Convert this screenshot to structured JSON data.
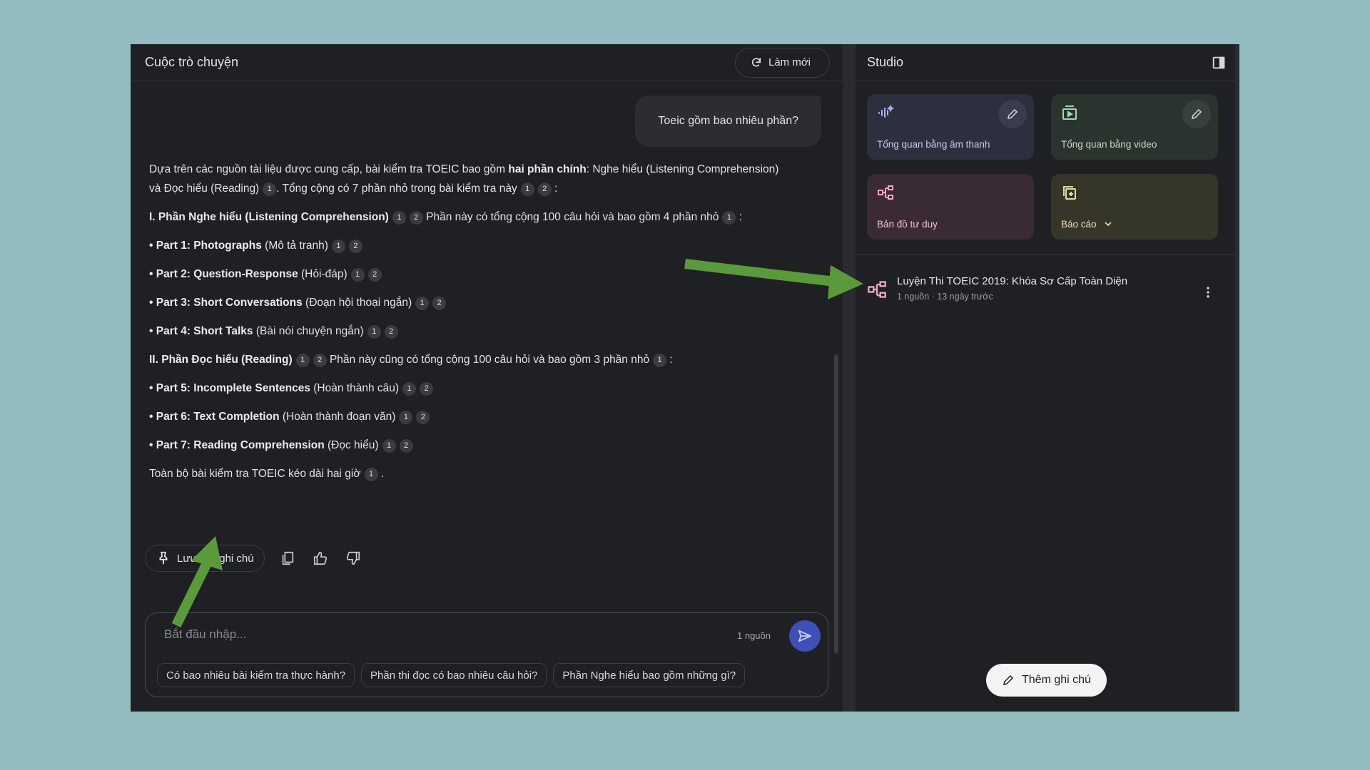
{
  "chat": {
    "title": "Cuộc trò chuyện",
    "refresh_label": "Làm mới",
    "user_message": "Toeic gồm bao nhiêu phần?",
    "answer": {
      "intro_a": "Dựa trên các nguồn tài liệu được cung cấp, bài kiểm tra TOEIC bao gồm ",
      "intro_b": "hai phần chính",
      "intro_c": ": Nghe hiểu (Listening Comprehension) và Đọc hiểu (Reading)",
      "intro_d": ". Tổng cộng có 7 phần nhỏ trong bài kiểm tra này",
      "listening_head": "I. Phần Nghe hiểu (Listening Comprehension)",
      "listening_desc": "Phần này có tổng cộng 100 câu hỏi và bao gồm 4 phần nhỏ",
      "part1_name": "• Part 1: Photographs",
      "part1_vi": " (Mô tả tranh)",
      "part2_name": "• Part 2: Question-Response",
      "part2_vi": " (Hỏi-đáp)",
      "part3_name": "• Part 3: Short Conversations",
      "part3_vi": " (Đoạn hội thoại ngắn)",
      "part4_name": "• Part 4: Short Talks",
      "part4_vi": " (Bài nói chuyện ngắn)",
      "reading_head": "II. Phần Đọc hiểu (Reading)",
      "reading_desc": "Phần này cũng có tổng cộng 100 câu hỏi và bao gồm 3 phần nhỏ",
      "part5_name": "• Part 5: Incomplete Sentences",
      "part5_vi": " (Hoàn thành câu)",
      "part6_name": "• Part 6: Text Completion",
      "part6_vi": " (Hoàn thành đoạn văn)",
      "part7_name": "• Part 7: Reading Comprehension",
      "part7_vi": " (Đọc hiểu)",
      "closing": "Toàn bộ bài kiểm tra TOEIC kéo dài hai giờ",
      "colon": " :",
      "period": " ."
    },
    "citations": {
      "c1": "1",
      "c2": "2"
    },
    "save_note_label": "Lưu vào ghi chú",
    "input_placeholder": "Bắt đầu nhập...",
    "source_count": "1 nguồn",
    "suggestions": [
      "Có bao nhiêu bài kiểm tra thực hành?",
      "Phần thi đọc có bao nhiêu câu hỏi?",
      "Phần Nghe hiểu bao gồm những gì?"
    ]
  },
  "studio": {
    "title": "Studio",
    "tiles": [
      {
        "label": "Tổng quan bằng âm thanh",
        "icon": "audio-waveform-icon"
      },
      {
        "label": "Tổng quan bằng video",
        "icon": "video-icon"
      },
      {
        "label": "Bản đồ tư duy",
        "icon": "mind-map-icon"
      },
      {
        "label": "Báo cáo",
        "icon": "report-icon"
      }
    ],
    "note": {
      "title": "Luyện Thi TOEIC 2019: Khóa Sơ Cấp Toàn Diện",
      "meta": "1 nguồn · 13 ngày trước"
    },
    "add_note_label": "Thêm ghi chú"
  },
  "colors": {
    "background": "#93bcc0",
    "panel": "#1f2023",
    "send_button": "#3e4fb8",
    "annotation_arrow": "#5b9a3a"
  }
}
